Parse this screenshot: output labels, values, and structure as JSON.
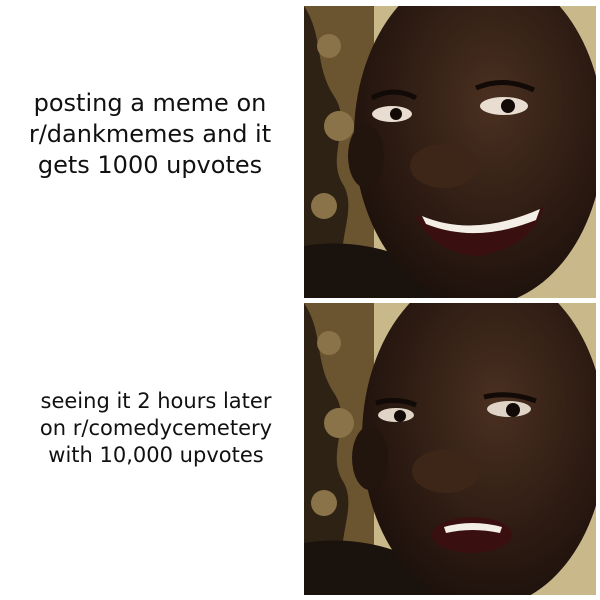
{
  "panels": [
    {
      "caption_lines": [
        "posting a meme on",
        "r/dankmemes and it",
        "gets 1000 upvotes"
      ],
      "expression": "smiling"
    },
    {
      "caption_lines": [
        "seeing it 2 hours later",
        "on r/comedycemetery",
        "with 10,000 upvotes"
      ],
      "expression": "disappointed"
    }
  ],
  "colors": {
    "background": "#ffffff",
    "text": "#111111",
    "skin": "#2b1a12",
    "skin_highlight": "#4a3020",
    "backdrop": "#6b5530",
    "backdrop_dark": "#2e2214",
    "wall": "#c9b98a",
    "teeth": "#f3efe6"
  }
}
